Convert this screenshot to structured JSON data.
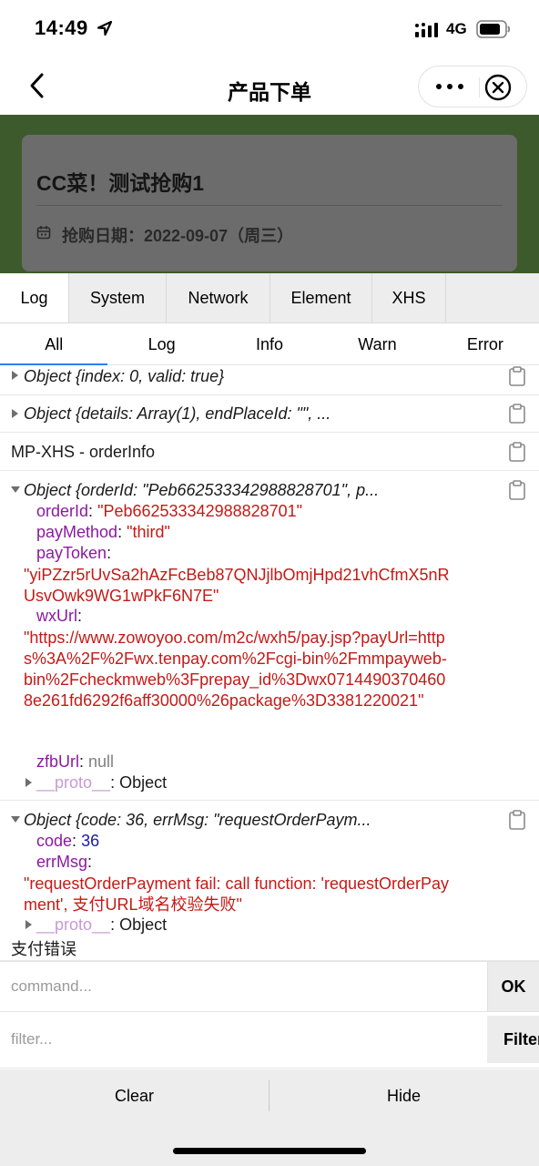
{
  "status_bar": {
    "time": "14:49",
    "network": "4G"
  },
  "nav": {
    "title": "产品下单"
  },
  "product": {
    "title": "CC菜！测试抢购1",
    "date_label": "抢购日期：2022-09-07（周三）"
  },
  "vconsole": {
    "tabs": [
      "Log",
      "System",
      "Network",
      "Element",
      "XHS"
    ],
    "subtabs": [
      "All",
      "Log",
      "Info",
      "Warn",
      "Error"
    ],
    "logs": {
      "row1": "Object {index: 0, valid: true}",
      "row2": "Object {details: Array(1), endPlaceId: \"\", ...",
      "row3": "MP-XHS - orderInfo",
      "row4": {
        "head": "Object {orderId: \"Peb662533342988828701\", p...",
        "orderId_key": "orderId",
        "orderId_val": "\"Peb662533342988828701\"",
        "payMethod_key": "payMethod",
        "payMethod_val": "\"third\"",
        "payToken_key": "payToken",
        "payToken_val": "\"yiPZzr5rUvSa2hAzFcBeb87QNJjlbOmjHpd21vhCfmX5nRUsvOwk9WG1wPkF6N7E\"",
        "wxUrl_key": "wxUrl",
        "wxUrl_val": "\"https://www.zowoyoo.com/m2c/wxh5/pay.jsp?payUrl=https%3A%2F%2Fwx.tenpay.com%2Fcgi-bin%2Fmmpayweb-bin%2Fcheckmweb%3Fprepay_id%3Dwx07144903704608e261fd6292f6aff30000%26package%3D3381220021\"",
        "zfbUrl_key": "zfbUrl",
        "zfbUrl_val": "null",
        "proto_key": "__proto__",
        "proto_val": "Object"
      },
      "row5": {
        "head": "Object {code: 36, errMsg: \"requestOrderPaym...",
        "code_key": "code",
        "code_val": "36",
        "errMsg_key": "errMsg",
        "errMsg_val": "\"requestOrderPayment fail: call function: 'requestOrderPayment', 支付URL域名校验失败\"",
        "proto_key": "__proto__",
        "proto_val": "Object",
        "tail": "支付错误"
      }
    },
    "command_placeholder": "command...",
    "ok_label": "OK",
    "filter_placeholder": "filter...",
    "filter_label": "Filter",
    "clear_label": "Clear",
    "hide_label": "Hide"
  }
}
